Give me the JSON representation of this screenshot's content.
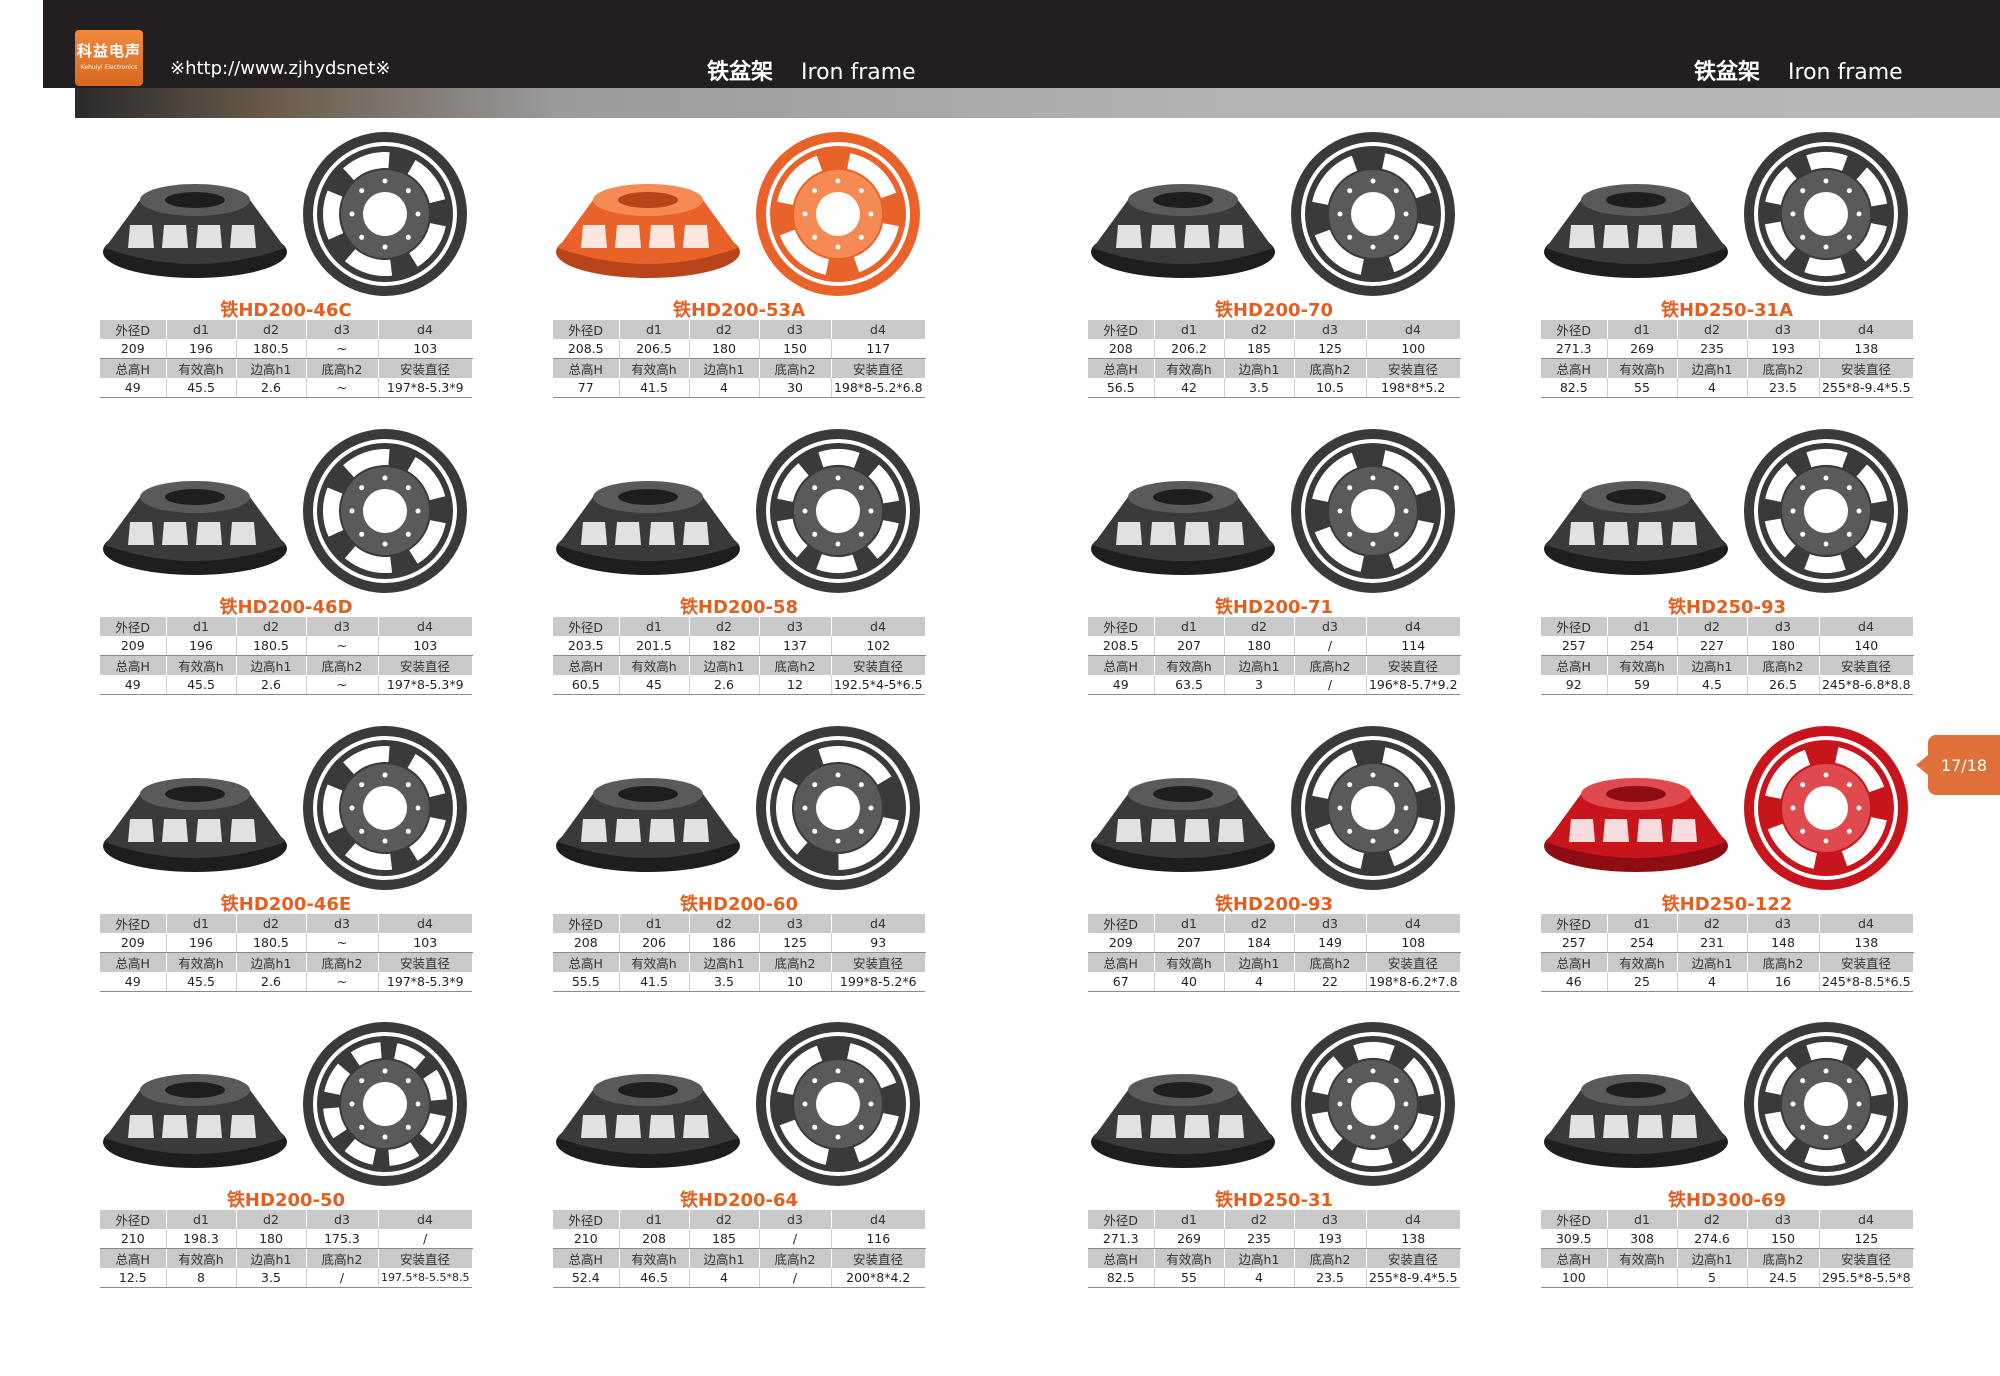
{
  "header": {
    "logo_cn": "科益电声",
    "logo_en": "Kehuiyi Electronics",
    "url": "※http://www.zjhydsnet※",
    "left_section_zh": "铁盆架",
    "left_section_en": "Iron frame",
    "right_section_zh": "铁盆架",
    "right_section_en": "Iron frame"
  },
  "page_tab": "17/18",
  "labels": {
    "row1": [
      "外径D",
      "d1",
      "d2",
      "d3",
      "d4"
    ],
    "row2": [
      "总高H",
      "有效高h",
      "边高h1",
      "底高h2",
      "安装直径"
    ]
  },
  "colors": {
    "accent": "#e45e1f",
    "header_bg": "#231f20",
    "table_header_bg": "#c9c9c9",
    "black_frame": "#3a3a3a",
    "orange_frame": "#e8622a",
    "red_frame": "#c8151b"
  },
  "products": [
    {
      "name": "铁HD200-46C",
      "color": "black",
      "spokes": 5,
      "row1": [
        "209",
        "196",
        "180.5",
        "~",
        "103"
      ],
      "row2": [
        "49",
        "45.5",
        "2.6",
        "~",
        "197*8-5.3*9"
      ]
    },
    {
      "name": "铁HD200-53A",
      "color": "orange",
      "spokes": 4,
      "row1": [
        "208.5",
        "206.5",
        "180",
        "150",
        "117"
      ],
      "row2": [
        "77",
        "41.5",
        "4",
        "30",
        "198*8-5.2*6.8"
      ]
    },
    {
      "name": "铁HD200-70",
      "color": "black",
      "spokes": 4,
      "row1": [
        "208",
        "206.2",
        "185",
        "125",
        "100"
      ],
      "row2": [
        "56.5",
        "42",
        "3.5",
        "10.5",
        "198*8*5.2"
      ]
    },
    {
      "name": "铁HD250-31A",
      "color": "black",
      "spokes": 6,
      "row1": [
        "271.3",
        "269",
        "235",
        "193",
        "138"
      ],
      "row2": [
        "82.5",
        "55",
        "4",
        "23.5",
        "255*8-9.4*5.5"
      ]
    },
    {
      "name": "铁HD200-46D",
      "color": "black",
      "spokes": 5,
      "row1": [
        "209",
        "196",
        "180.5",
        "~",
        "103"
      ],
      "row2": [
        "49",
        "45.5",
        "2.6",
        "~",
        "197*8-5.3*9"
      ]
    },
    {
      "name": "铁HD200-58",
      "color": "black",
      "spokes": 6,
      "row1": [
        "203.5",
        "201.5",
        "182",
        "137",
        "102"
      ],
      "row2": [
        "60.5",
        "45",
        "2.6",
        "12",
        "192.5*4-5*6.5"
      ]
    },
    {
      "name": "铁HD200-71",
      "color": "black",
      "spokes": 4,
      "row1": [
        "208.5",
        "207",
        "180",
        "/",
        "114"
      ],
      "row2": [
        "49",
        "63.5",
        "3",
        "/",
        "196*8-5.7*9.2"
      ]
    },
    {
      "name": "铁HD250-93",
      "color": "black",
      "spokes": 6,
      "row1": [
        "257",
        "254",
        "227",
        "180",
        "140"
      ],
      "row2": [
        "92",
        "59",
        "4.5",
        "26.5",
        "245*8-6.8*8.8"
      ]
    },
    {
      "name": "铁HD200-46E",
      "color": "black",
      "spokes": 5,
      "row1": [
        "209",
        "196",
        "180.5",
        "~",
        "103"
      ],
      "row2": [
        "49",
        "45.5",
        "2.6",
        "~",
        "197*8-5.3*9"
      ]
    },
    {
      "name": "铁HD200-60",
      "color": "black",
      "spokes": 3,
      "row1": [
        "208",
        "206",
        "186",
        "125",
        "93"
      ],
      "row2": [
        "55.5",
        "41.5",
        "3.5",
        "10",
        "199*8-5.2*6"
      ]
    },
    {
      "name": "铁HD200-93",
      "color": "black",
      "spokes": 4,
      "row1": [
        "209",
        "207",
        "184",
        "149",
        "108"
      ],
      "row2": [
        "67",
        "40",
        "4",
        "22",
        "198*8-6.2*7.8"
      ]
    },
    {
      "name": "铁HD250-122",
      "color": "red",
      "spokes": 4,
      "row1": [
        "257",
        "254",
        "231",
        "148",
        "138"
      ],
      "row2": [
        "46",
        "25",
        "4",
        "16",
        "245*8-8.5*6.5"
      ]
    },
    {
      "name": "铁HD200-50",
      "color": "black",
      "spokes": 8,
      "row1": [
        "210",
        "198.3",
        "180",
        "175.3",
        "/"
      ],
      "row2": [
        "12.5",
        "8",
        "3.5",
        "/",
        "197.5*8-5.5*8.5"
      ]
    },
    {
      "name": "铁HD200-64",
      "color": "black",
      "spokes": 4,
      "row1": [
        "210",
        "208",
        "185",
        "/",
        "116"
      ],
      "row2": [
        "52.4",
        "46.5",
        "4",
        "/",
        "200*8*4.2"
      ]
    },
    {
      "name": "铁HD250-31",
      "color": "black",
      "spokes": 6,
      "row1": [
        "271.3",
        "269",
        "235",
        "193",
        "138"
      ],
      "row2": [
        "82.5",
        "55",
        "4",
        "23.5",
        "255*8-9.4*5.5"
      ]
    },
    {
      "name": "铁HD300-69",
      "color": "black",
      "spokes": 6,
      "row1": [
        "309.5",
        "308",
        "274.6",
        "150",
        "125"
      ],
      "row2": [
        "100",
        "",
        "5",
        "24.5",
        "295.5*8-5.5*8"
      ]
    }
  ]
}
